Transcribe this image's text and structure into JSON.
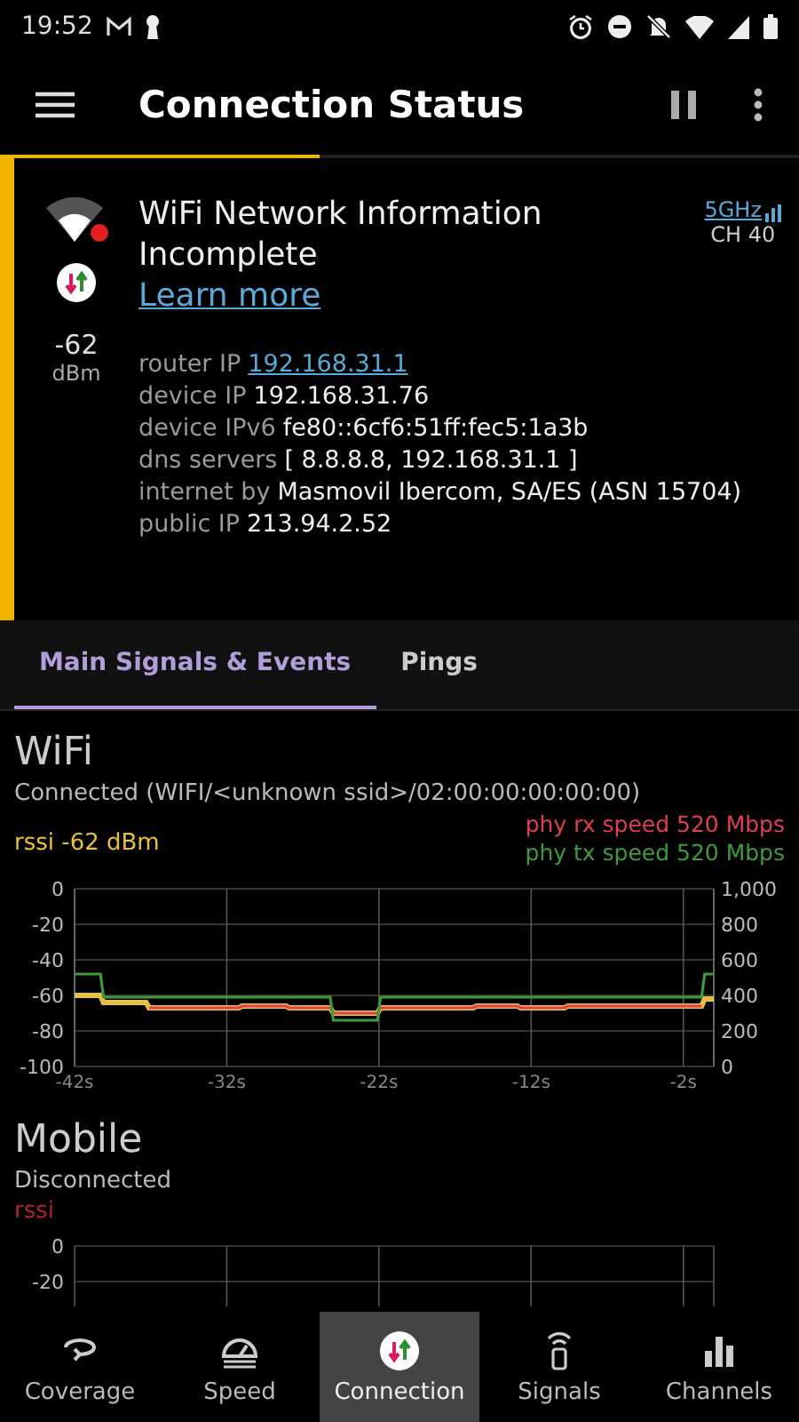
{
  "status_bar": {
    "time": "19:52"
  },
  "app_bar": {
    "title": "Connection Status"
  },
  "scan_progress": {
    "level": 0.4
  },
  "network_card": {
    "signal": "-62",
    "signal_unit": "dBm",
    "title": "WiFi Network Information Incomplete",
    "link": "Learn more",
    "band": "5GHz",
    "channel": "CH 40",
    "details": [
      {
        "label": "router IP",
        "value": "192.168.31.1",
        "link": true
      },
      {
        "label": "device IP",
        "value": "192.168.31.76",
        "link": false
      },
      {
        "label": "device IPv6",
        "value": "fe80::6cf6:51ff:fec5:1a3b",
        "link": false
      },
      {
        "label": "dns servers",
        "value": "[ 8.8.8.8, 192.168.31.1 ]",
        "link": false
      },
      {
        "label": "internet by",
        "value": "Masmovil Ibercom, SA/ES (ASN 15704)",
        "link": false
      },
      {
        "label": "public IP",
        "value": "213.94.2.52",
        "link": false
      }
    ]
  },
  "tabs": [
    {
      "label": "Main Signals & Events",
      "selected": true
    },
    {
      "label": "Pings",
      "selected": false
    }
  ],
  "wifi": {
    "title": "WiFi",
    "status": "Connected (WIFI/<unknown ssid>/02:00:00:00:00:00)",
    "chart_data": {
      "type": "line",
      "grid": true,
      "x": [
        -42,
        -40.3,
        -40.1,
        -37.3,
        -37.1,
        -31.2,
        -31,
        -28.1,
        -27.9,
        -25.2,
        -25,
        -22.1,
        -21.9,
        -15.8,
        -15.6,
        -12.9,
        -12.7,
        -9.8,
        -9.6,
        -0.8,
        -0.6,
        0
      ],
      "xlim": [
        -42,
        0
      ],
      "ylim": [
        -100,
        0
      ],
      "xticks": [
        {
          "value": -42,
          "label": "-42s"
        },
        {
          "value": -32,
          "label": "-32s"
        },
        {
          "value": -22,
          "label": "-22s"
        },
        {
          "value": -12,
          "label": "-12s"
        },
        {
          "value": -2,
          "label": "-2s"
        }
      ],
      "yticks": [
        0,
        -20,
        -40,
        -60,
        -80,
        -100
      ],
      "y2lim": [
        0,
        1000
      ],
      "y2ticks": [
        {
          "value": 1000,
          "label": "1,000"
        },
        {
          "value": 800,
          "label": "800"
        },
        {
          "value": 600,
          "label": "600"
        },
        {
          "value": 400,
          "label": "400"
        },
        {
          "value": 200,
          "label": "200"
        },
        {
          "value": 0,
          "label": "0"
        }
      ],
      "series": [
        {
          "name": "rssi -62 dBm",
          "color": "#e8c040",
          "values": [
            -60,
            -60,
            -64,
            -64,
            -67,
            -67,
            -66,
            -66,
            -67,
            -67,
            -70,
            -70,
            -67,
            -67,
            -66,
            -66,
            -67,
            -67,
            -66,
            -66,
            -62,
            -62
          ]
        },
        {
          "name": "phy rx speed 520 Mbps",
          "color": "#e0404e",
          "axis": "y2",
          "values": [
            null,
            null,
            null,
            null,
            330,
            330,
            340,
            340,
            330,
            330,
            300,
            300,
            330,
            330,
            340,
            340,
            330,
            330,
            340,
            340,
            null,
            null
          ]
        },
        {
          "name": "phy tx speed 520 Mbps",
          "color": "#3f9a3a",
          "axis": "y2",
          "values": [
            520,
            520,
            390,
            390,
            390,
            390,
            390,
            390,
            390,
            390,
            260,
            260,
            390,
            390,
            390,
            390,
            390,
            390,
            390,
            390,
            520,
            520
          ]
        }
      ]
    }
  },
  "mobile": {
    "title": "Mobile",
    "status": "Disconnected",
    "rssi": "rssi",
    "yticks": [
      "0",
      "-20"
    ]
  },
  "bottom_nav": [
    {
      "label": "Coverage",
      "selected": false
    },
    {
      "label": "Speed",
      "selected": false
    },
    {
      "label": "Connection",
      "selected": true
    },
    {
      "label": "Signals",
      "selected": false
    },
    {
      "label": "Channels",
      "selected": false
    }
  ]
}
